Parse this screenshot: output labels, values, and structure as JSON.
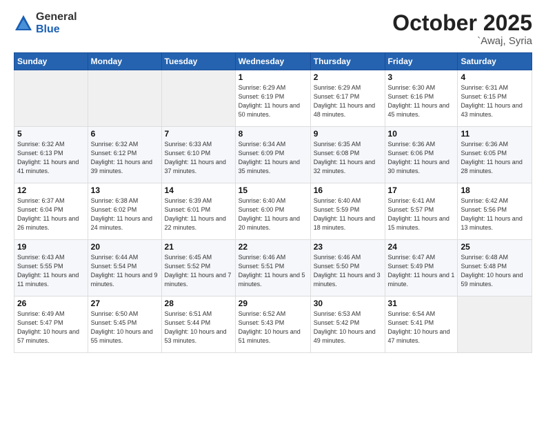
{
  "logo": {
    "general": "General",
    "blue": "Blue"
  },
  "header": {
    "month": "October 2025",
    "location": "`Awaj, Syria"
  },
  "weekdays": [
    "Sunday",
    "Monday",
    "Tuesday",
    "Wednesday",
    "Thursday",
    "Friday",
    "Saturday"
  ],
  "weeks": [
    [
      {
        "day": "",
        "sunrise": "",
        "sunset": "",
        "daylight": ""
      },
      {
        "day": "",
        "sunrise": "",
        "sunset": "",
        "daylight": ""
      },
      {
        "day": "",
        "sunrise": "",
        "sunset": "",
        "daylight": ""
      },
      {
        "day": "1",
        "sunrise": "Sunrise: 6:29 AM",
        "sunset": "Sunset: 6:19 PM",
        "daylight": "Daylight: 11 hours and 50 minutes."
      },
      {
        "day": "2",
        "sunrise": "Sunrise: 6:29 AM",
        "sunset": "Sunset: 6:17 PM",
        "daylight": "Daylight: 11 hours and 48 minutes."
      },
      {
        "day": "3",
        "sunrise": "Sunrise: 6:30 AM",
        "sunset": "Sunset: 6:16 PM",
        "daylight": "Daylight: 11 hours and 45 minutes."
      },
      {
        "day": "4",
        "sunrise": "Sunrise: 6:31 AM",
        "sunset": "Sunset: 6:15 PM",
        "daylight": "Daylight: 11 hours and 43 minutes."
      }
    ],
    [
      {
        "day": "5",
        "sunrise": "Sunrise: 6:32 AM",
        "sunset": "Sunset: 6:13 PM",
        "daylight": "Daylight: 11 hours and 41 minutes."
      },
      {
        "day": "6",
        "sunrise": "Sunrise: 6:32 AM",
        "sunset": "Sunset: 6:12 PM",
        "daylight": "Daylight: 11 hours and 39 minutes."
      },
      {
        "day": "7",
        "sunrise": "Sunrise: 6:33 AM",
        "sunset": "Sunset: 6:10 PM",
        "daylight": "Daylight: 11 hours and 37 minutes."
      },
      {
        "day": "8",
        "sunrise": "Sunrise: 6:34 AM",
        "sunset": "Sunset: 6:09 PM",
        "daylight": "Daylight: 11 hours and 35 minutes."
      },
      {
        "day": "9",
        "sunrise": "Sunrise: 6:35 AM",
        "sunset": "Sunset: 6:08 PM",
        "daylight": "Daylight: 11 hours and 32 minutes."
      },
      {
        "day": "10",
        "sunrise": "Sunrise: 6:36 AM",
        "sunset": "Sunset: 6:06 PM",
        "daylight": "Daylight: 11 hours and 30 minutes."
      },
      {
        "day": "11",
        "sunrise": "Sunrise: 6:36 AM",
        "sunset": "Sunset: 6:05 PM",
        "daylight": "Daylight: 11 hours and 28 minutes."
      }
    ],
    [
      {
        "day": "12",
        "sunrise": "Sunrise: 6:37 AM",
        "sunset": "Sunset: 6:04 PM",
        "daylight": "Daylight: 11 hours and 26 minutes."
      },
      {
        "day": "13",
        "sunrise": "Sunrise: 6:38 AM",
        "sunset": "Sunset: 6:02 PM",
        "daylight": "Daylight: 11 hours and 24 minutes."
      },
      {
        "day": "14",
        "sunrise": "Sunrise: 6:39 AM",
        "sunset": "Sunset: 6:01 PM",
        "daylight": "Daylight: 11 hours and 22 minutes."
      },
      {
        "day": "15",
        "sunrise": "Sunrise: 6:40 AM",
        "sunset": "Sunset: 6:00 PM",
        "daylight": "Daylight: 11 hours and 20 minutes."
      },
      {
        "day": "16",
        "sunrise": "Sunrise: 6:40 AM",
        "sunset": "Sunset: 5:59 PM",
        "daylight": "Daylight: 11 hours and 18 minutes."
      },
      {
        "day": "17",
        "sunrise": "Sunrise: 6:41 AM",
        "sunset": "Sunset: 5:57 PM",
        "daylight": "Daylight: 11 hours and 15 minutes."
      },
      {
        "day": "18",
        "sunrise": "Sunrise: 6:42 AM",
        "sunset": "Sunset: 5:56 PM",
        "daylight": "Daylight: 11 hours and 13 minutes."
      }
    ],
    [
      {
        "day": "19",
        "sunrise": "Sunrise: 6:43 AM",
        "sunset": "Sunset: 5:55 PM",
        "daylight": "Daylight: 11 hours and 11 minutes."
      },
      {
        "day": "20",
        "sunrise": "Sunrise: 6:44 AM",
        "sunset": "Sunset: 5:54 PM",
        "daylight": "Daylight: 11 hours and 9 minutes."
      },
      {
        "day": "21",
        "sunrise": "Sunrise: 6:45 AM",
        "sunset": "Sunset: 5:52 PM",
        "daylight": "Daylight: 11 hours and 7 minutes."
      },
      {
        "day": "22",
        "sunrise": "Sunrise: 6:46 AM",
        "sunset": "Sunset: 5:51 PM",
        "daylight": "Daylight: 11 hours and 5 minutes."
      },
      {
        "day": "23",
        "sunrise": "Sunrise: 6:46 AM",
        "sunset": "Sunset: 5:50 PM",
        "daylight": "Daylight: 11 hours and 3 minutes."
      },
      {
        "day": "24",
        "sunrise": "Sunrise: 6:47 AM",
        "sunset": "Sunset: 5:49 PM",
        "daylight": "Daylight: 11 hours and 1 minute."
      },
      {
        "day": "25",
        "sunrise": "Sunrise: 6:48 AM",
        "sunset": "Sunset: 5:48 PM",
        "daylight": "Daylight: 10 hours and 59 minutes."
      }
    ],
    [
      {
        "day": "26",
        "sunrise": "Sunrise: 6:49 AM",
        "sunset": "Sunset: 5:47 PM",
        "daylight": "Daylight: 10 hours and 57 minutes."
      },
      {
        "day": "27",
        "sunrise": "Sunrise: 6:50 AM",
        "sunset": "Sunset: 5:45 PM",
        "daylight": "Daylight: 10 hours and 55 minutes."
      },
      {
        "day": "28",
        "sunrise": "Sunrise: 6:51 AM",
        "sunset": "Sunset: 5:44 PM",
        "daylight": "Daylight: 10 hours and 53 minutes."
      },
      {
        "day": "29",
        "sunrise": "Sunrise: 6:52 AM",
        "sunset": "Sunset: 5:43 PM",
        "daylight": "Daylight: 10 hours and 51 minutes."
      },
      {
        "day": "30",
        "sunrise": "Sunrise: 6:53 AM",
        "sunset": "Sunset: 5:42 PM",
        "daylight": "Daylight: 10 hours and 49 minutes."
      },
      {
        "day": "31",
        "sunrise": "Sunrise: 6:54 AM",
        "sunset": "Sunset: 5:41 PM",
        "daylight": "Daylight: 10 hours and 47 minutes."
      },
      {
        "day": "",
        "sunrise": "",
        "sunset": "",
        "daylight": ""
      }
    ]
  ]
}
